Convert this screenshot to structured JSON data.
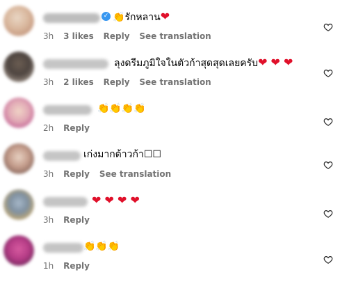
{
  "comments": [
    {
      "text": "รักหลาน",
      "emoji_prefix": "👏",
      "emoji_suffix": "❤",
      "time": "3h",
      "likes": "3 likes",
      "reply": "Reply",
      "translation": "See translation",
      "verified": true
    },
    {
      "text": "ลุงดรีมภูมิใจในตัวก้าสุดสุดเลยครับ",
      "emoji_prefix": "",
      "emoji_suffix": "❤ ❤ ❤",
      "time": "3h",
      "likes": "2 likes",
      "reply": "Reply",
      "translation": "See translation",
      "verified": false
    },
    {
      "text": "",
      "emoji_prefix": "👏👏👏👏",
      "emoji_suffix": "",
      "time": "2h",
      "likes": "",
      "reply": "Reply",
      "translation": "",
      "verified": false
    },
    {
      "text": "เก่งมากต้าวก้า☐☐",
      "emoji_prefix": "",
      "emoji_suffix": "",
      "time": "3h",
      "likes": "",
      "reply": "Reply",
      "translation": "See translation",
      "verified": false
    },
    {
      "text": "",
      "emoji_prefix": "❤ ❤ ❤ ❤",
      "emoji_suffix": "",
      "time": "3h",
      "likes": "",
      "reply": "Reply",
      "translation": "",
      "verified": false
    },
    {
      "text": "",
      "emoji_prefix": "👏👏👏",
      "emoji_suffix": "",
      "time": "1h",
      "likes": "",
      "reply": "Reply",
      "translation": "",
      "verified": false
    }
  ],
  "icons": {
    "like": "heart-outline-icon",
    "verified": "verified-badge-icon"
  },
  "colors": {
    "meta_text": "#737373",
    "heart": "#e0102a",
    "verified": "#3797f0"
  }
}
